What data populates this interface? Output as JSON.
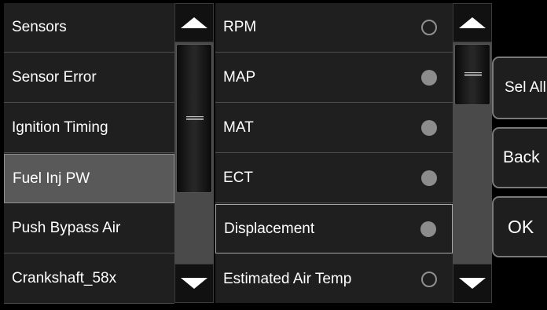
{
  "left_list": {
    "items": [
      {
        "label": "Sensors"
      },
      {
        "label": "Sensor Error"
      },
      {
        "label": "Ignition Timing"
      },
      {
        "label": "Fuel Inj PW"
      },
      {
        "label": "Push Bypass Air"
      },
      {
        "label": "Crankshaft_58x"
      }
    ],
    "selected_item": "Fuel Inj PW"
  },
  "right_list": {
    "items": [
      {
        "label": "RPM",
        "radio": "empty"
      },
      {
        "label": "MAP",
        "radio": "filled"
      },
      {
        "label": "MAT",
        "radio": "filled"
      },
      {
        "label": "ECT",
        "radio": "filled"
      },
      {
        "label": "Displacement",
        "radio": "filled"
      },
      {
        "label": "Estimated Air Temp",
        "radio": "empty"
      }
    ]
  },
  "buttons": {
    "sel_all": "Sel All",
    "back": "Back",
    "ok": "OK"
  },
  "icons": {
    "scroll_up": "triangle-up-icon",
    "scroll_down": "triangle-down-icon",
    "thumb_grip": "grip-icon"
  },
  "colors": {
    "background": "#000000",
    "panel": "#1f1f1f",
    "selected_row": "#595959",
    "radio_filled": "#8c8c8c",
    "scroll_track": "#4a4a4a"
  }
}
